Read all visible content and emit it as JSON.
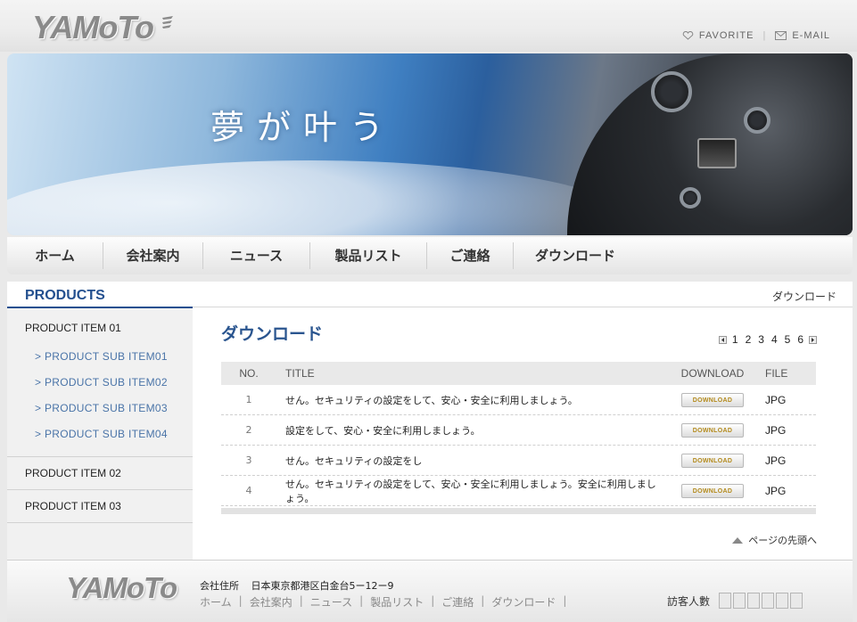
{
  "header": {
    "logo": "YAMoTo",
    "links": [
      {
        "icon": "heart-icon",
        "label": "FAVORITE"
      },
      {
        "icon": "mail-icon",
        "label": "E-MAIL"
      }
    ]
  },
  "banner": {
    "slogan": "夢が叶う"
  },
  "nav": {
    "items": [
      "ホーム",
      "会社案内",
      "ニュース",
      "製品リスト",
      "ご連絡",
      "ダウンロード"
    ]
  },
  "sidebar": {
    "heading": "PRODUCTS",
    "item1": "PRODUCT ITEM 01",
    "subitems": [
      "> PRODUCT SUB ITEM01",
      "> PRODUCT SUB ITEM02",
      "> PRODUCT SUB ITEM03",
      "> PRODUCT SUB ITEM04"
    ],
    "item2": "PRODUCT ITEM 02",
    "item3": "PRODUCT ITEM 03"
  },
  "main": {
    "breadcrumb": "ダウンロード",
    "title": "ダウンロード",
    "pages": [
      "1",
      "2",
      "3",
      "4",
      "5",
      "6"
    ],
    "columns": [
      "NO.",
      "TITLE",
      "DOWNLOAD",
      "FILE"
    ],
    "download_label": "DOWNLOAD",
    "rows": [
      {
        "no": "1",
        "title": "せん。セキュリティの設定をして、安心・安全に利用しましょう。",
        "file": "JPG"
      },
      {
        "no": "2",
        "title": "設定をして、安心・安全に利用しましょう。",
        "file": "JPG"
      },
      {
        "no": "3",
        "title": "せん。セキュリティの設定をし",
        "file": "JPG"
      },
      {
        "no": "4",
        "title": "せん。セキュリティの設定をして、安心・安全に利用しましょう。安全に利用しましょう。",
        "file": "JPG"
      }
    ],
    "to_top": "ページの先頭へ"
  },
  "footer": {
    "logo": "YAMoTo",
    "address_label": "会社住所",
    "address": "日本東京都港区白金台5ー12ー9",
    "links": [
      "ホーム",
      "会社案内",
      "ニュース",
      "製品リスト",
      "ご連絡",
      "ダウンロード"
    ],
    "counter_label": "訪客人數"
  }
}
